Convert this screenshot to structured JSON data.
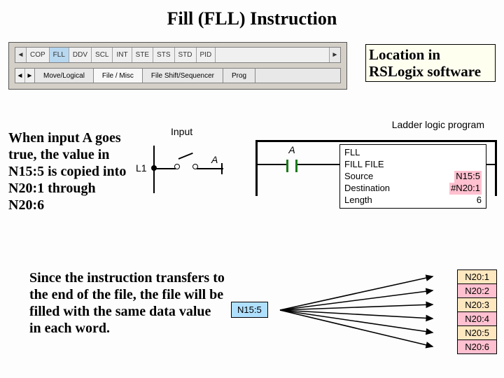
{
  "title": "Fill (FLL) Instruction",
  "location_label": "Location in RSLogix software",
  "toolbar": {
    "buttons": [
      "COP",
      "FLL",
      "DDV",
      "SCL",
      "INT",
      "STE",
      "STS",
      "STD",
      "PID"
    ],
    "selected": "FLL",
    "tabs": [
      "Move/Logical",
      "File / Misc",
      "File Shift/Sequencer",
      "Prog"
    ],
    "active_tab": "File / Misc"
  },
  "desc1": "When input A goes true, the value in N15:5 is copied into N20:1 through N20:6",
  "desc2": "Since the instruction transfers to the end of the file, the file will be filled with the same data value in each word.",
  "input_diagram": {
    "title": "Input",
    "rail": "L1",
    "switch_label": "A"
  },
  "ladder": {
    "title": "Ladder logic program",
    "contact_label": "A",
    "block": {
      "mnemonic": "FLL",
      "name": "FILL FILE",
      "rows": [
        {
          "label": "Source",
          "value": "N15:5"
        },
        {
          "label": "Destination",
          "value": "#N20:1"
        },
        {
          "label": "Length",
          "value": "6"
        }
      ]
    }
  },
  "transfer": {
    "source": "N15:5",
    "dest": [
      "N20:1",
      "N20:2",
      "N20:3",
      "N20:4",
      "N20:5",
      "N20:6"
    ]
  }
}
